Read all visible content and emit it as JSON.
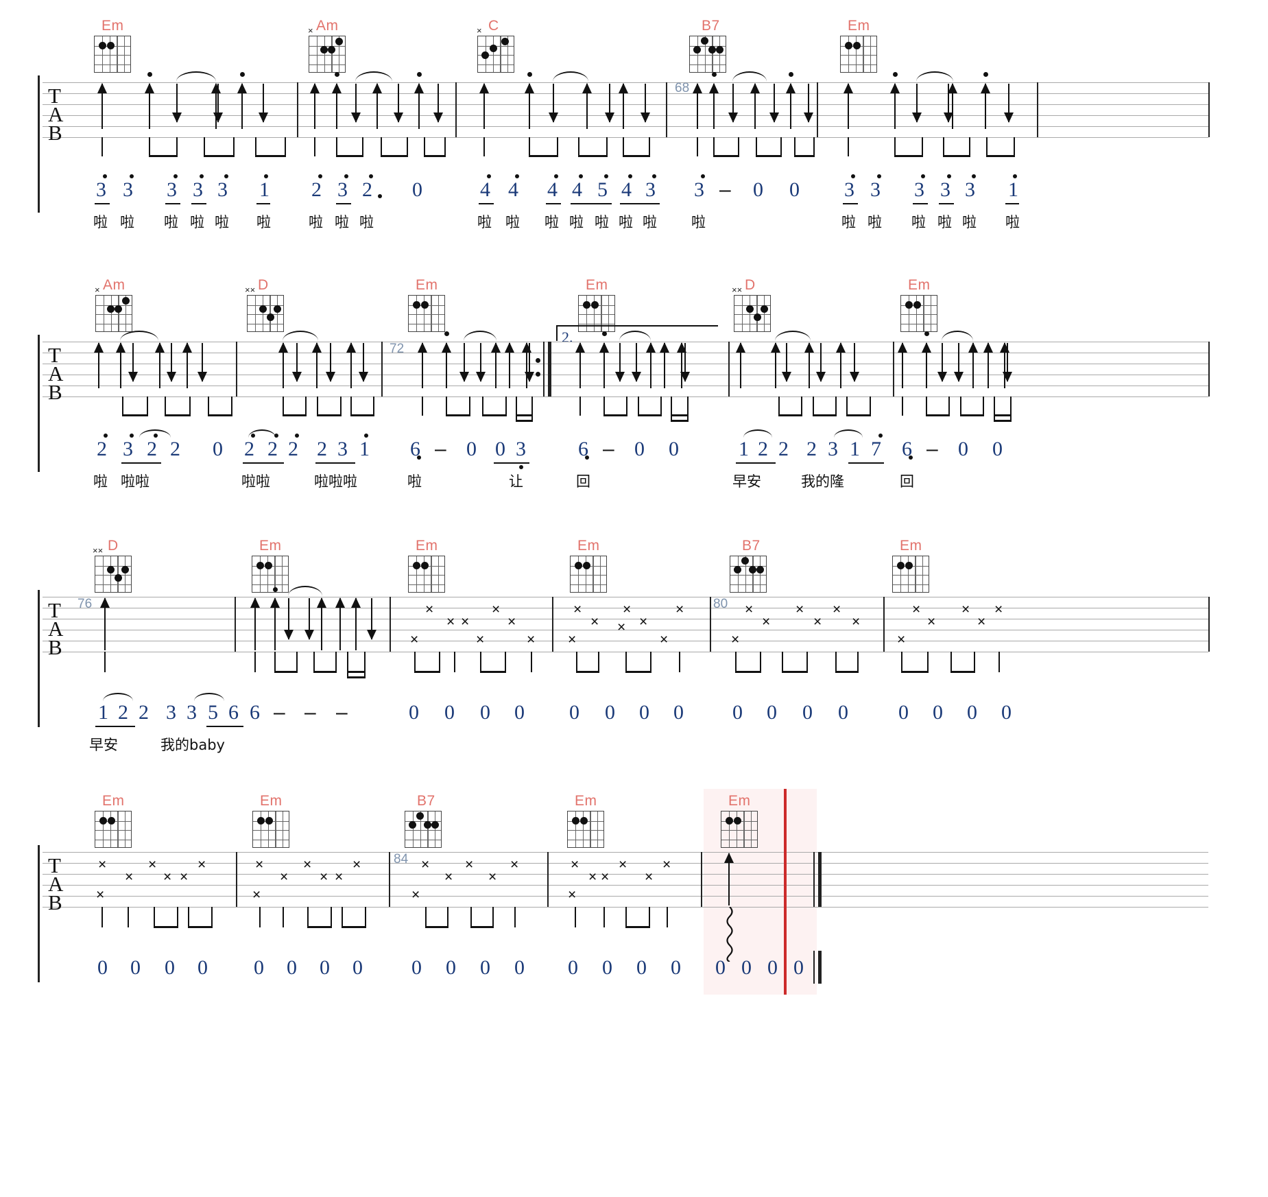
{
  "document": {
    "type": "guitar-tablature",
    "clef_label": "TAB",
    "chord_label_color": "#e2736c",
    "number_color": "#1b3a78",
    "measure_number_color": "#7f93ad",
    "cursor_color": "#cc2b2b",
    "highlight_color": "#f8e9e9"
  },
  "systems": [
    {
      "id": "system-1",
      "measure_numbers": [
        "68"
      ],
      "chords": [
        {
          "name": "Em",
          "muted_strings": [],
          "dots": [
            [
              2,
              1
            ],
            [
              3,
              1
            ]
          ]
        },
        {
          "name": "Am",
          "muted_strings": [
            1
          ],
          "dots": [
            [
              2,
              2
            ],
            [
              3,
              2
            ],
            [
              4,
              1
            ]
          ]
        },
        {
          "name": "C",
          "muted_strings": [
            1
          ],
          "dots": [
            [
              2,
              3
            ],
            [
              3,
              2
            ],
            [
              4,
              1
            ]
          ]
        },
        {
          "name": "B7",
          "muted_strings": [],
          "dots": [
            [
              2,
              1
            ],
            [
              3,
              2
            ],
            [
              4,
              2
            ],
            [
              5,
              2
            ]
          ]
        },
        {
          "name": "Em",
          "muted_strings": [],
          "dots": [
            [
              2,
              1
            ],
            [
              3,
              1
            ]
          ]
        }
      ],
      "numbers": [
        "3",
        "3",
        "3",
        "3",
        "3",
        "1",
        "2",
        "3",
        "2.",
        "0",
        "4",
        "4",
        "4",
        "4",
        "5",
        "4",
        "3",
        "3",
        "–",
        "0",
        "0",
        "3",
        "3",
        "3",
        "3",
        "3",
        "1"
      ],
      "lyrics": [
        "啦",
        "啦",
        "啦",
        "啦",
        "啦",
        "啦",
        "啦",
        "啦",
        "啦",
        "啦",
        "啦",
        "啦",
        "啦",
        "啦",
        "啦",
        "啦",
        "啦",
        "啦",
        "啦",
        "啦",
        "啦",
        "啦",
        "啦"
      ]
    },
    {
      "id": "system-2",
      "measure_numbers": [
        "72"
      ],
      "chords": [
        {
          "name": "Am",
          "muted_strings": [
            1
          ],
          "dots": [
            [
              2,
              2
            ],
            [
              3,
              2
            ],
            [
              4,
              1
            ]
          ]
        },
        {
          "name": "D",
          "muted_strings": [
            1,
            2
          ],
          "dots": [
            [
              3,
              2
            ],
            [
              4,
              3
            ],
            [
              5,
              2
            ]
          ]
        },
        {
          "name": "Em",
          "muted_strings": [],
          "dots": [
            [
              2,
              1
            ],
            [
              3,
              1
            ]
          ]
        },
        {
          "name": "Em",
          "muted_strings": [],
          "dots": [
            [
              2,
              1
            ],
            [
              3,
              1
            ]
          ]
        },
        {
          "name": "D",
          "muted_strings": [
            1,
            2
          ],
          "dots": [
            [
              3,
              2
            ],
            [
              4,
              3
            ],
            [
              5,
              2
            ]
          ]
        },
        {
          "name": "Em",
          "muted_strings": [],
          "dots": [
            [
              2,
              1
            ],
            [
              3,
              1
            ]
          ]
        }
      ],
      "volta": "2.",
      "numbers": [
        "2",
        "3",
        "2",
        "2",
        "0",
        "2",
        "2",
        "2",
        "2",
        "3",
        "1",
        "6",
        "–",
        "0",
        "0",
        "3",
        "6",
        "–",
        "0",
        "0",
        "1",
        "2",
        "2",
        "2",
        "3",
        "1",
        "7",
        "6",
        "–",
        "0",
        "0"
      ],
      "lyrics": [
        "啦",
        "啦啦",
        "啦啦",
        "啦啦啦",
        "啦",
        "让",
        "回",
        "早安",
        "我的隆",
        "回"
      ]
    },
    {
      "id": "system-3",
      "measure_numbers": [
        "76",
        "80"
      ],
      "chords": [
        {
          "name": "D",
          "muted_strings": [
            1,
            2
          ],
          "dots": [
            [
              3,
              2
            ],
            [
              4,
              3
            ],
            [
              5,
              2
            ]
          ]
        },
        {
          "name": "Em",
          "muted_strings": [],
          "dots": [
            [
              2,
              1
            ],
            [
              3,
              1
            ]
          ]
        },
        {
          "name": "Em",
          "muted_strings": [],
          "dots": [
            [
              2,
              1
            ],
            [
              3,
              1
            ]
          ]
        },
        {
          "name": "Em",
          "muted_strings": [],
          "dots": [
            [
              2,
              1
            ],
            [
              3,
              1
            ]
          ]
        },
        {
          "name": "B7",
          "muted_strings": [],
          "dots": [
            [
              2,
              1
            ],
            [
              3,
              2
            ],
            [
              4,
              2
            ],
            [
              5,
              2
            ]
          ]
        },
        {
          "name": "Em",
          "muted_strings": [],
          "dots": [
            [
              2,
              1
            ],
            [
              3,
              1
            ]
          ]
        }
      ],
      "numbers": [
        "1",
        "2",
        "2",
        "3",
        "3",
        "5",
        "6",
        "6",
        "–",
        "–",
        "–",
        "0",
        "0",
        "0",
        "0",
        "0",
        "0",
        "0",
        "0",
        "0",
        "0",
        "0",
        "0",
        "0",
        "0",
        "0",
        "0"
      ],
      "lyrics": [
        "早安",
        "我的baby"
      ]
    },
    {
      "id": "system-4",
      "measure_numbers": [
        "84"
      ],
      "chords": [
        {
          "name": "Em",
          "muted_strings": [],
          "dots": [
            [
              2,
              1
            ],
            [
              3,
              1
            ]
          ]
        },
        {
          "name": "Em",
          "muted_strings": [],
          "dots": [
            [
              2,
              1
            ],
            [
              3,
              1
            ]
          ]
        },
        {
          "name": "B7",
          "muted_strings": [],
          "dots": [
            [
              2,
              1
            ],
            [
              3,
              2
            ],
            [
              4,
              2
            ],
            [
              5,
              2
            ]
          ]
        },
        {
          "name": "Em",
          "muted_strings": [],
          "dots": [
            [
              2,
              1
            ],
            [
              3,
              1
            ]
          ]
        },
        {
          "name": "Em",
          "muted_strings": [],
          "dots": [
            [
              2,
              1
            ],
            [
              3,
              1
            ]
          ]
        }
      ],
      "numbers": [
        "0",
        "0",
        "0",
        "0",
        "0",
        "0",
        "0",
        "0",
        "0",
        "0",
        "0",
        "0",
        "0",
        "0",
        "0",
        "0",
        "0",
        "0",
        "0",
        "0"
      ],
      "lyrics": []
    }
  ]
}
